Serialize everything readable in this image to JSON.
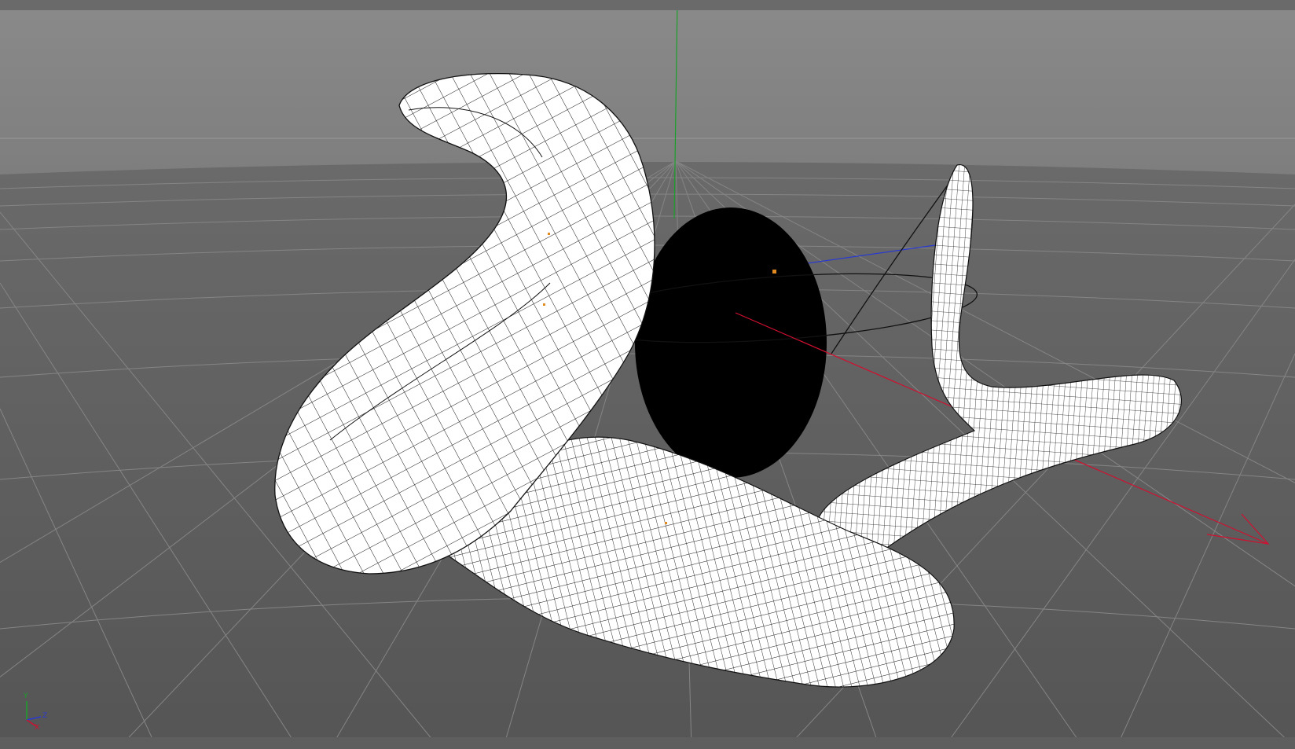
{
  "viewport": {
    "view_name": "perspective-viewport",
    "colors": {
      "sky_top": "#8a8a8a",
      "sky_bottom": "#7c7c7c",
      "floor": "#5f5f5f",
      "grid_line": "#8c8c8c",
      "axis_x": "#d01030",
      "axis_y": "#1aa02a",
      "axis_z": "#2a3ad0",
      "mesh_fill": "#ffffff",
      "mesh_wire": "#1a1a1a",
      "sphere": "#000000",
      "vertex_dot": "#e08a20"
    }
  },
  "axis_gizmo": {
    "y_label": "Y",
    "z_label": "Z",
    "x_label": "X"
  }
}
